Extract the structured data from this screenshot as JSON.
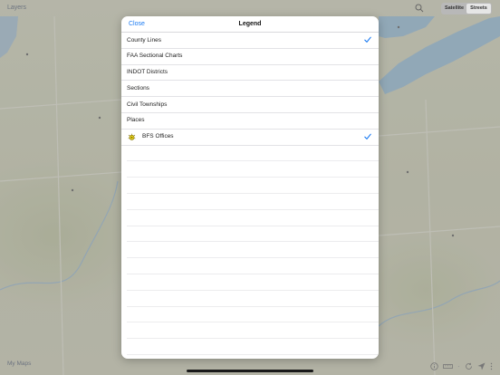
{
  "topbar": {
    "layers_label": "Layers",
    "segment": {
      "options": [
        "Satellite",
        "Streets"
      ],
      "selected": "Streets"
    }
  },
  "bottombar": {
    "my_maps_label": "My Maps"
  },
  "legend": {
    "close_label": "Close",
    "title": "Legend",
    "items": [
      {
        "label": "County Lines",
        "checked": true
      },
      {
        "label": "FAA Sectional Charts",
        "checked": false
      },
      {
        "label": "INDOT Districts",
        "checked": false
      },
      {
        "label": "Sections",
        "checked": false
      },
      {
        "label": "Civil Townships",
        "checked": false
      },
      {
        "label": "Places",
        "checked": false
      },
      {
        "label": "BFS Offices",
        "checked": true,
        "icon": "bfs-office-icon"
      }
    ]
  },
  "colors": {
    "accent": "#1b7bf2",
    "map_land": "#d6d6c3",
    "lake": "#a7c6dc"
  }
}
